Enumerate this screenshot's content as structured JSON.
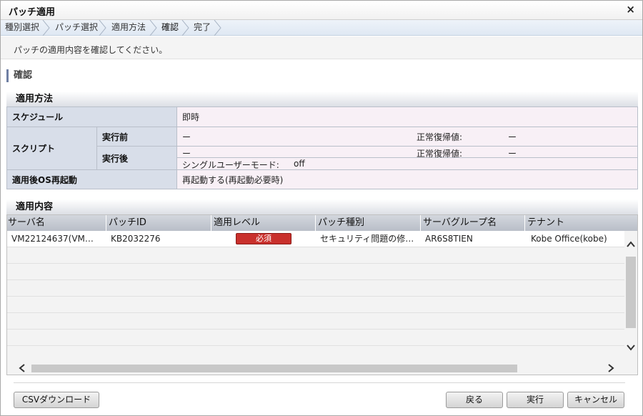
{
  "window": {
    "title": "パッチ適用",
    "close_glyph": "×"
  },
  "steps": [
    {
      "label": "種別選択"
    },
    {
      "label": "パッチ選択"
    },
    {
      "label": "適用方法"
    },
    {
      "label": "確認"
    },
    {
      "label": "完了"
    }
  ],
  "instruction": "パッチの適用内容を確認してください。",
  "section_title": "確認",
  "method": {
    "heading": "適用方法",
    "schedule_label": "スケジュール",
    "schedule_value": "即時",
    "script_label": "スクリプト",
    "pre_label": "実行前",
    "pre_value": "ー",
    "pre_rc_label": "正常復帰値:",
    "pre_rc_value": "ー",
    "post_label": "実行後",
    "post_value": "ー",
    "post_rc_label": "正常復帰値:",
    "post_rc_value": "ー",
    "single_user_label": "シングルユーザーモード:",
    "single_user_value": "off",
    "reboot_label": "適用後OS再起動",
    "reboot_value": "再起動する(再起動必要時)"
  },
  "content": {
    "heading": "適用内容",
    "columns": [
      "サーバ名",
      "パッチID",
      "適用レベル",
      "パッチ種別",
      "サーバグループ名",
      "テナント"
    ],
    "rows": [
      {
        "server": "VM22124637(VM…",
        "patch_id": "KB2032276",
        "level": "必須",
        "type": "セキュリティ問題の修…",
        "group": "AR6S8TIEN",
        "tenant": "Kobe Office(kobe)"
      }
    ]
  },
  "buttons": {
    "csv": "CSVダウンロード",
    "back": "戻る",
    "execute": "実行",
    "cancel": "キャンセル"
  },
  "colors": {
    "badge_required": "#c9302c",
    "label_cell": "#d8dee9",
    "value_cell": "#f8f0f6",
    "section_accent": "#6f7fa3"
  },
  "icons": {
    "scroll_up": "chevron-up-icon",
    "scroll_down": "chevron-down-icon",
    "scroll_left": "chevron-left-icon",
    "scroll_right": "chevron-right-icon"
  }
}
